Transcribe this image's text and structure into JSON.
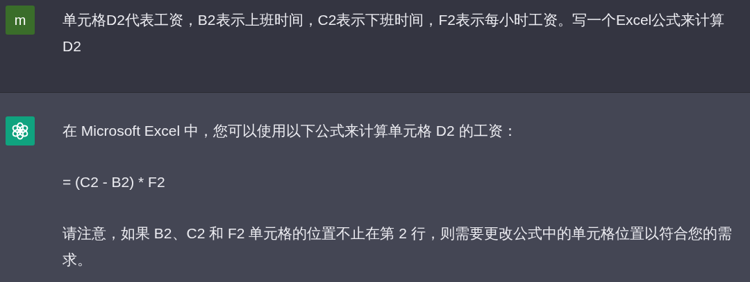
{
  "messages": [
    {
      "kind": "user",
      "avatar": "m",
      "paragraphs": [
        "单元格D2代表工资，B2表示上班时间，C2表示下班时间，F2表示每小时工资。写一个Excel公式来计算D2"
      ]
    },
    {
      "kind": "assistant",
      "paragraphs": [
        "在 Microsoft Excel 中，您可以使用以下公式来计算单元格 D2 的工资：",
        "= (C2 - B2) * F2",
        "请注意，如果 B2、C2 和 F2 单元格的位置不止在第 2 行，则需要更改公式中的单元格位置以符合您的需求。"
      ]
    }
  ]
}
